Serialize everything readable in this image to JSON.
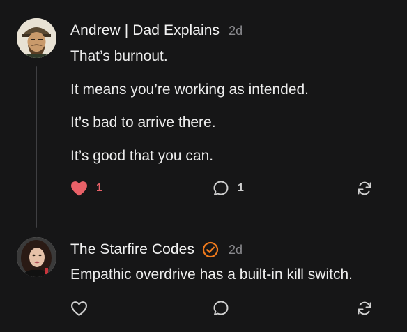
{
  "comments": [
    {
      "author": "Andrew | Dad Explains",
      "time": "2d",
      "paragraphs": [
        "That’s burnout.",
        "It means you’re working as intended.",
        "It’s bad to arrive there.",
        "It’s good that you can."
      ],
      "likes": "1",
      "replies": "1",
      "liked": true
    },
    {
      "author": "The Starfire Codes",
      "time": "2d",
      "verified": true,
      "paragraphs": [
        "Empathic overdrive has a built-in kill switch."
      ],
      "likes": "",
      "replies": ""
    }
  ],
  "colors": {
    "background": "#161617",
    "like_active": "#e86168",
    "verified_badge": "#f07a1c",
    "thread_line": "#3f3f42"
  },
  "icons": [
    "heart-icon",
    "comment-icon",
    "restack-icon",
    "verified-badge-icon"
  ]
}
